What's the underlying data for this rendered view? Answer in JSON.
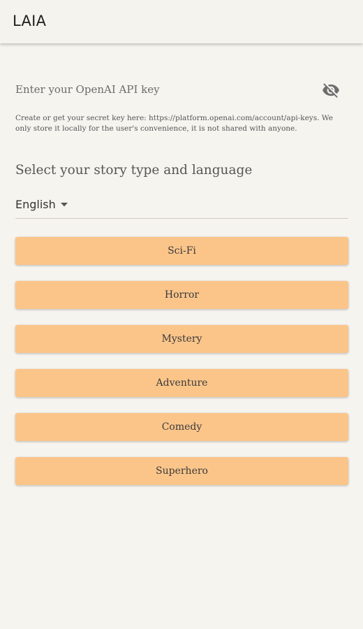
{
  "app": {
    "title": "LAIA"
  },
  "api_key": {
    "placeholder": "Enter your OpenAI API key",
    "value": "",
    "visibility_icon": "eye-off-icon",
    "helper_text": "Create or get your secret key here: https://platform.openai.com/account/api-keys. We only store it locally for the user's convenience, it is not shared with anyone."
  },
  "story": {
    "section_title": "Select your story type and language",
    "language": {
      "selected": "English",
      "icon": "dropdown-arrow-icon"
    },
    "types": [
      {
        "label": "Sci-Fi"
      },
      {
        "label": "Horror"
      },
      {
        "label": "Mystery"
      },
      {
        "label": "Adventure"
      },
      {
        "label": "Comedy"
      },
      {
        "label": "Superhero"
      }
    ]
  },
  "colors": {
    "background": "#f6f4ef",
    "button": "#fbc58a",
    "divider": "#cfcac2"
  }
}
